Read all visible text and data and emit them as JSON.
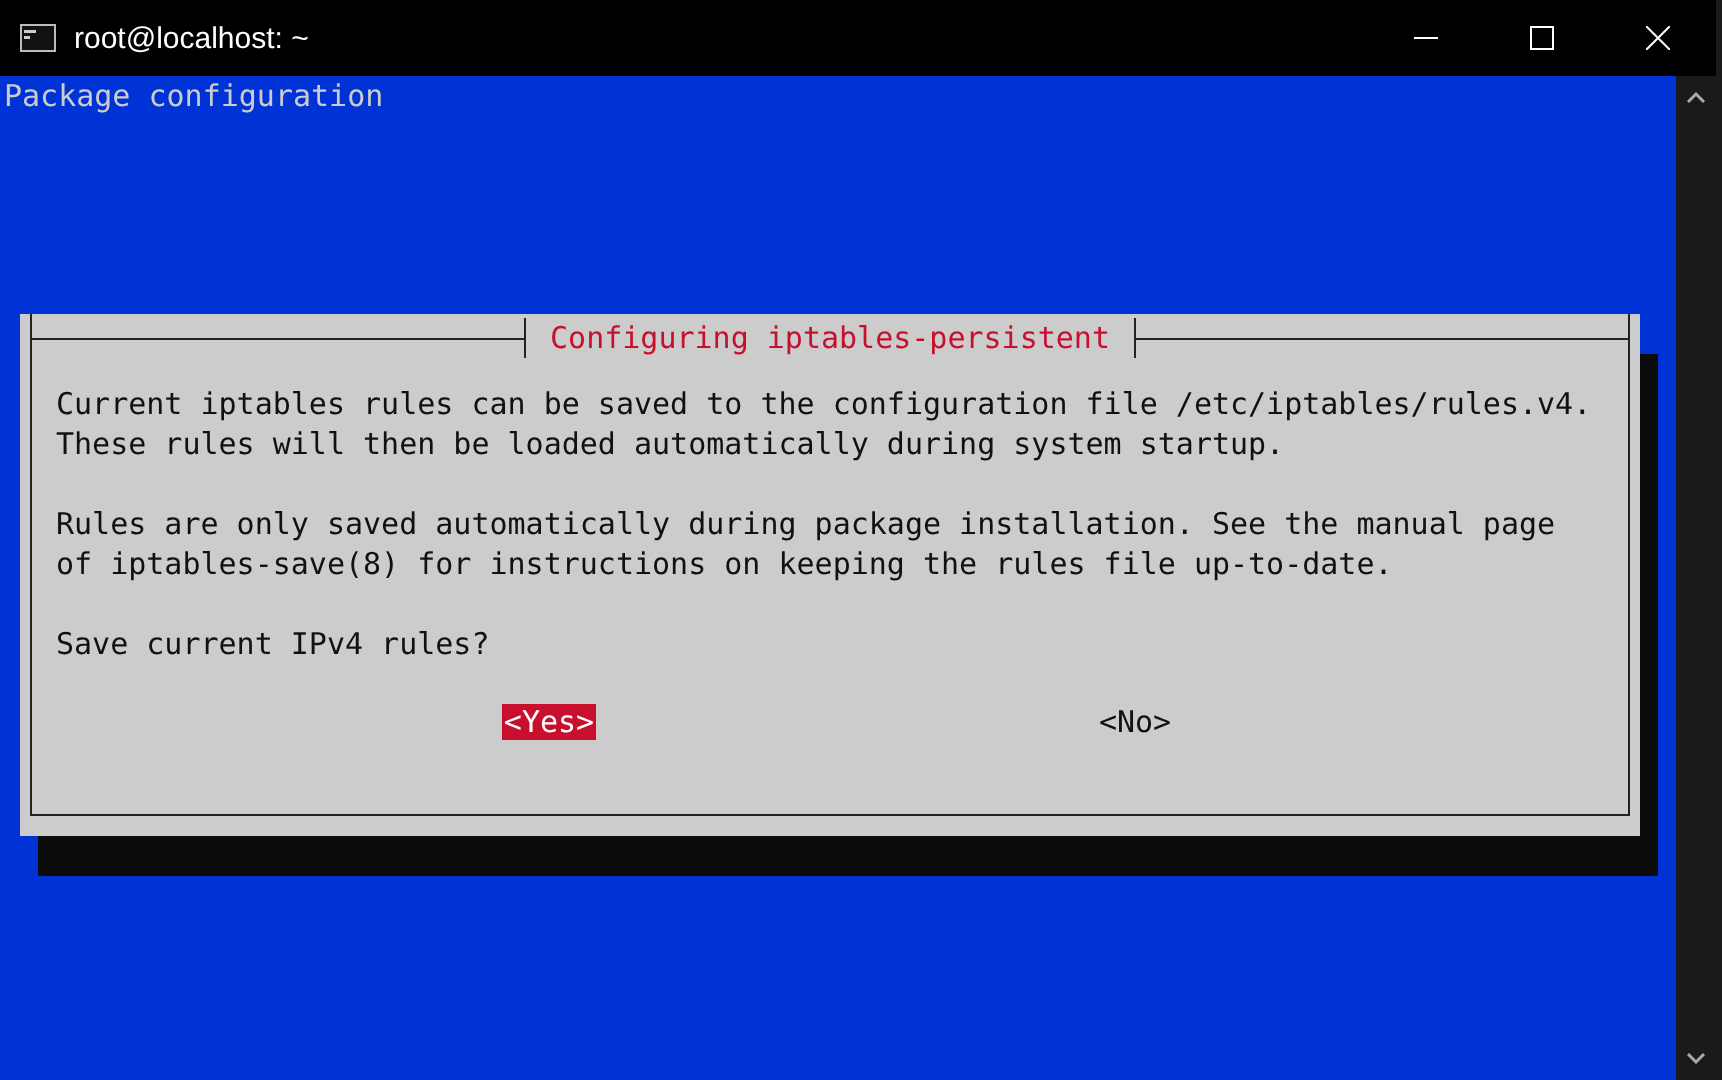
{
  "window": {
    "title": "root@localhost: ~"
  },
  "terminal": {
    "header": "Package configuration"
  },
  "dialog": {
    "title": "Configuring iptables-persistent",
    "paragraphs": [
      [
        "Current iptables rules can be saved to the configuration file /etc/iptables/rules.v4.",
        "These rules will then be loaded automatically during system startup."
      ],
      [
        "Rules are only saved automatically during package installation. See the manual page",
        "of iptables-save(8) for instructions on keeping the rules file up-to-date."
      ],
      [
        "Save current IPv4 rules?"
      ]
    ],
    "buttons": [
      {
        "label": "<Yes>",
        "selected": true
      },
      {
        "label": "<No>",
        "selected": false
      }
    ]
  }
}
